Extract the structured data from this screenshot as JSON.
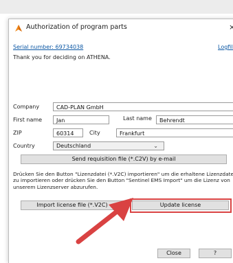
{
  "dialog": {
    "title": "Authorization of program parts",
    "close_symbol": "×",
    "serial_link": "Serial number: 69734038",
    "logfile_link": "Logfile",
    "thank_you": "Thank you for deciding on ATHENA."
  },
  "form": {
    "company_label": "Company",
    "company_value": "CAD-PLAN GmbH",
    "first_name_label": "First name",
    "first_name_value": "Jan",
    "last_name_label": "Last name",
    "last_name_value": "Behrendt",
    "zip_label": "ZIP",
    "zip_value": "60314",
    "city_label": "City",
    "city_value": "Frankfurt",
    "country_label": "Country",
    "country_value": "Deutschland"
  },
  "buttons": {
    "send_request": "Send requisition file (*.C2V) by e-mail",
    "import_license": "Import license file (*.V2C)",
    "update_license": "Update license",
    "close": "Close",
    "help": "?"
  },
  "instructions": "Drücken Sie den Button \"Lizenzdatei (*.V2C) importieren\" um die erhaltene Lizenzdatei zu importieren oder drücken Sie den Button \"Sentinel EMS Import\" um die Lizenz von unserem Lizenzserver abzurufen.",
  "colors": {
    "link": "#0b57a4",
    "highlight": "#d94242",
    "logo": "#f28b1e"
  },
  "icons": {
    "logo": "athena-logo-icon",
    "dropdown": "chevron-down-icon",
    "annotation": "red-arrow-icon"
  }
}
